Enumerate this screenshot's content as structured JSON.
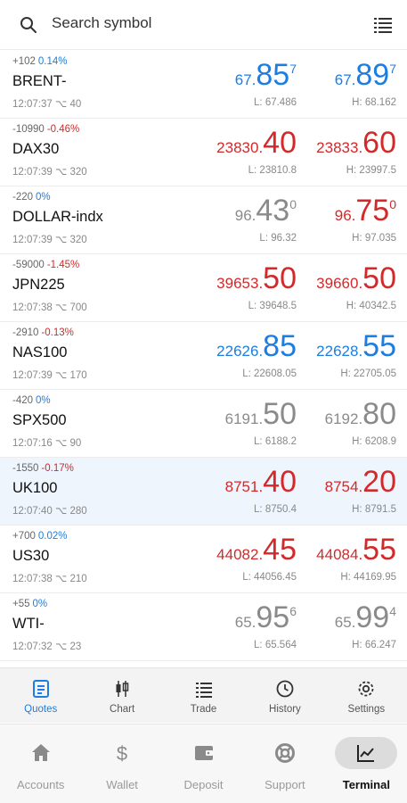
{
  "search": {
    "placeholder": "Search symbol"
  },
  "colors": {
    "up": "#1e7de0",
    "down": "#d22a2a",
    "neutral": "#8a8a8a"
  },
  "quotes": [
    {
      "change_points": "+102",
      "change_pct": "0.14%",
      "change_dir": "blue",
      "symbol": "BRENT-",
      "time": "12:07:37",
      "ticks": "40",
      "bid_small": "67.",
      "bid_big": "85",
      "bid_sup": "7",
      "bid_color": "blue",
      "ask_small": "67.",
      "ask_big": "89",
      "ask_sup": "7",
      "ask_color": "blue",
      "low": "L: 67.486",
      "high": "H: 68.162"
    },
    {
      "change_points": "-10990",
      "change_pct": "-0.46%",
      "change_dir": "red",
      "symbol": "DAX30",
      "time": "12:07:39",
      "ticks": "320",
      "bid_small": "23830.",
      "bid_big": "40",
      "bid_sup": "",
      "bid_color": "red",
      "ask_small": "23833.",
      "ask_big": "60",
      "ask_sup": "",
      "ask_color": "red",
      "low": "L: 23810.8",
      "high": "H: 23997.5"
    },
    {
      "change_points": "-220",
      "change_pct": "0%",
      "change_dir": "blue",
      "symbol": "DOLLAR-indx",
      "time": "12:07:39",
      "ticks": "320",
      "bid_small": "96.",
      "bid_big": "43",
      "bid_sup": "0",
      "bid_color": "gray",
      "ask_small": "96.",
      "ask_big": "75",
      "ask_sup": "0",
      "ask_color": "red",
      "low": "L: 96.32",
      "high": "H: 97.035"
    },
    {
      "change_points": "-59000",
      "change_pct": "-1.45%",
      "change_dir": "red",
      "symbol": "JPN225",
      "time": "12:07:38",
      "ticks": "700",
      "bid_small": "39653.",
      "bid_big": "50",
      "bid_sup": "",
      "bid_color": "red",
      "ask_small": "39660.",
      "ask_big": "50",
      "ask_sup": "",
      "ask_color": "red",
      "low": "L: 39648.5",
      "high": "H: 40342.5"
    },
    {
      "change_points": "-2910",
      "change_pct": "-0.13%",
      "change_dir": "red",
      "symbol": "NAS100",
      "time": "12:07:39",
      "ticks": "170",
      "bid_small": "22626.",
      "bid_big": "85",
      "bid_sup": "",
      "bid_color": "blue",
      "ask_small": "22628.",
      "ask_big": "55",
      "ask_sup": "",
      "ask_color": "blue",
      "low": "L: 22608.05",
      "high": "H: 22705.05"
    },
    {
      "change_points": "-420",
      "change_pct": "0%",
      "change_dir": "blue",
      "symbol": "SPX500",
      "time": "12:07:16",
      "ticks": "90",
      "bid_small": "6191.",
      "bid_big": "50",
      "bid_sup": "",
      "bid_color": "gray",
      "ask_small": "6192.",
      "ask_big": "80",
      "ask_sup": "",
      "ask_color": "gray",
      "low": "L: 6188.2",
      "high": "H: 6208.9"
    },
    {
      "change_points": "-1550",
      "change_pct": "-0.17%",
      "change_dir": "red",
      "symbol": "UK100",
      "time": "12:07:40",
      "ticks": "280",
      "bid_small": "8751.",
      "bid_big": "40",
      "bid_sup": "",
      "bid_color": "red",
      "ask_small": "8754.",
      "ask_big": "20",
      "ask_sup": "",
      "ask_color": "red",
      "low": "L: 8750.4",
      "high": "H: 8791.5",
      "selected": true
    },
    {
      "change_points": "+700",
      "change_pct": "0.02%",
      "change_dir": "blue",
      "symbol": "US30",
      "time": "12:07:38",
      "ticks": "210",
      "bid_small": "44082.",
      "bid_big": "45",
      "bid_sup": "",
      "bid_color": "red",
      "ask_small": "44084.",
      "ask_big": "55",
      "ask_sup": "",
      "ask_color": "red",
      "low": "L: 44056.45",
      "high": "H: 44169.95"
    },
    {
      "change_points": "+55",
      "change_pct": "0%",
      "change_dir": "blue",
      "symbol": "WTI-",
      "time": "12:07:32",
      "ticks": "23",
      "bid_small": "65.",
      "bid_big": "95",
      "bid_sup": "6",
      "bid_color": "gray",
      "ask_small": "65.",
      "ask_big": "99",
      "ask_sup": "4",
      "ask_color": "gray",
      "low": "L: 65.564",
      "high": "H: 66.247"
    }
  ],
  "tabs": [
    {
      "label": "Quotes",
      "icon": "quotes-icon",
      "active": true
    },
    {
      "label": "Chart",
      "icon": "candlestick-chart-icon"
    },
    {
      "label": "Trade",
      "icon": "trade-list-icon"
    },
    {
      "label": "History",
      "icon": "history-clock-icon"
    },
    {
      "label": "Settings",
      "icon": "gear-icon"
    }
  ],
  "nav": [
    {
      "label": "Accounts",
      "icon": "home-icon"
    },
    {
      "label": "Wallet",
      "icon": "dollar-icon"
    },
    {
      "label": "Deposit",
      "icon": "wallet-icon"
    },
    {
      "label": "Support",
      "icon": "lifebuoy-icon"
    },
    {
      "label": "Terminal",
      "icon": "line-chart-icon",
      "active": true
    }
  ]
}
